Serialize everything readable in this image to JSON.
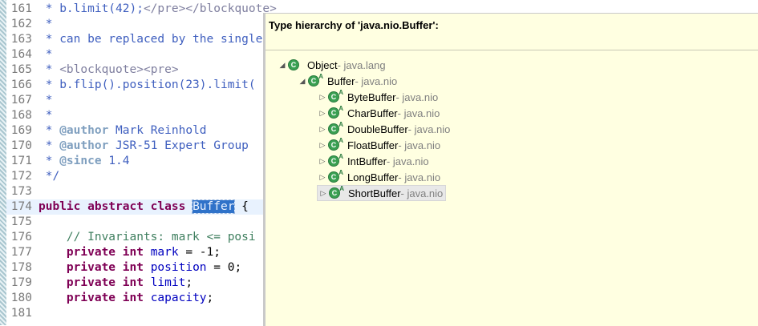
{
  "editor": {
    "lines": [
      {
        "num": "161",
        "parts": [
          {
            "t": " * b.limit(42);",
            "c": "jd"
          },
          {
            "t": "</pre></blockquote>",
            "c": "tag"
          }
        ]
      },
      {
        "num": "162",
        "parts": [
          {
            "t": " *",
            "c": "jd"
          }
        ]
      },
      {
        "num": "163",
        "parts": [
          {
            "t": " * can be replaced by the single",
            "c": "jd"
          }
        ]
      },
      {
        "num": "164",
        "parts": [
          {
            "t": " *",
            "c": "jd"
          }
        ]
      },
      {
        "num": "165",
        "parts": [
          {
            "t": " * ",
            "c": "jd"
          },
          {
            "t": "<blockquote><pre>",
            "c": "tag"
          }
        ]
      },
      {
        "num": "166",
        "parts": [
          {
            "t": " * b.flip().position(23).limit(",
            "c": "jd"
          }
        ]
      },
      {
        "num": "167",
        "parts": [
          {
            "t": " *",
            "c": "jd"
          }
        ]
      },
      {
        "num": "168",
        "parts": [
          {
            "t": " *",
            "c": "jd"
          }
        ]
      },
      {
        "num": "169",
        "parts": [
          {
            "t": " * ",
            "c": "jd"
          },
          {
            "t": "@author",
            "c": "at"
          },
          {
            "t": " Mark Reinhold",
            "c": "jd"
          }
        ]
      },
      {
        "num": "170",
        "parts": [
          {
            "t": " * ",
            "c": "jd"
          },
          {
            "t": "@author",
            "c": "at"
          },
          {
            "t": " JSR-51 Expert Group",
            "c": "jd"
          }
        ]
      },
      {
        "num": "171",
        "parts": [
          {
            "t": " * ",
            "c": "jd"
          },
          {
            "t": "@since",
            "c": "at"
          },
          {
            "t": " 1.4",
            "c": "jd"
          }
        ]
      },
      {
        "num": "172",
        "parts": [
          {
            "t": " */",
            "c": "jd"
          }
        ]
      },
      {
        "num": "173",
        "parts": []
      },
      {
        "num": "174",
        "parts": [
          {
            "t": "public abstract class ",
            "c": "kw"
          },
          {
            "t": "Buffer",
            "c": "sel"
          },
          {
            "t": " {",
            "c": "plain"
          }
        ],
        "current": true
      },
      {
        "num": "175",
        "parts": []
      },
      {
        "num": "176",
        "parts": [
          {
            "t": "    // Invariants: mark <= posi",
            "c": "cm"
          }
        ]
      },
      {
        "num": "177",
        "parts": [
          {
            "t": "    ",
            "c": "plain"
          },
          {
            "t": "private int ",
            "c": "kw"
          },
          {
            "t": "mark",
            "c": "fld"
          },
          {
            "t": " = -1;",
            "c": "plain"
          }
        ]
      },
      {
        "num": "178",
        "parts": [
          {
            "t": "    ",
            "c": "plain"
          },
          {
            "t": "private int ",
            "c": "kw"
          },
          {
            "t": "position",
            "c": "fld"
          },
          {
            "t": " = 0;",
            "c": "plain"
          }
        ]
      },
      {
        "num": "179",
        "parts": [
          {
            "t": "    ",
            "c": "plain"
          },
          {
            "t": "private int ",
            "c": "kw"
          },
          {
            "t": "limit",
            "c": "fld"
          },
          {
            "t": ";",
            "c": "plain"
          }
        ]
      },
      {
        "num": "180",
        "parts": [
          {
            "t": "    ",
            "c": "plain"
          },
          {
            "t": "private int ",
            "c": "kw"
          },
          {
            "t": "capacity",
            "c": "fld"
          },
          {
            "t": ";",
            "c": "plain"
          }
        ]
      },
      {
        "num": "181",
        "parts": []
      }
    ]
  },
  "popup": {
    "title": "Type hierarchy of 'java.nio.Buffer':",
    "nodes": [
      {
        "name": "Object",
        "pkg": " - java.lang",
        "expanded": true,
        "abstract": false,
        "level": 0
      },
      {
        "name": "Buffer",
        "pkg": " - java.nio",
        "expanded": true,
        "abstract": true,
        "level": 1
      },
      {
        "name": "ByteBuffer",
        "pkg": " - java.nio",
        "expanded": false,
        "abstract": true,
        "level": 2
      },
      {
        "name": "CharBuffer",
        "pkg": " - java.nio",
        "expanded": false,
        "abstract": true,
        "level": 2
      },
      {
        "name": "DoubleBuffer",
        "pkg": " - java.nio",
        "expanded": false,
        "abstract": true,
        "level": 2
      },
      {
        "name": "FloatBuffer",
        "pkg": " - java.nio",
        "expanded": false,
        "abstract": true,
        "level": 2
      },
      {
        "name": "IntBuffer",
        "pkg": " - java.nio",
        "expanded": false,
        "abstract": true,
        "level": 2
      },
      {
        "name": "LongBuffer",
        "pkg": " - java.nio",
        "expanded": false,
        "abstract": true,
        "level": 2
      },
      {
        "name": "ShortBuffer",
        "pkg": " - java.nio",
        "expanded": false,
        "abstract": true,
        "level": 2,
        "selected": true
      }
    ],
    "icon_letter": "C",
    "abstract_marker": "A",
    "colors": {
      "background": "#ffffe1",
      "class_icon": "#3aa052",
      "selection": "#2f72c9"
    }
  }
}
